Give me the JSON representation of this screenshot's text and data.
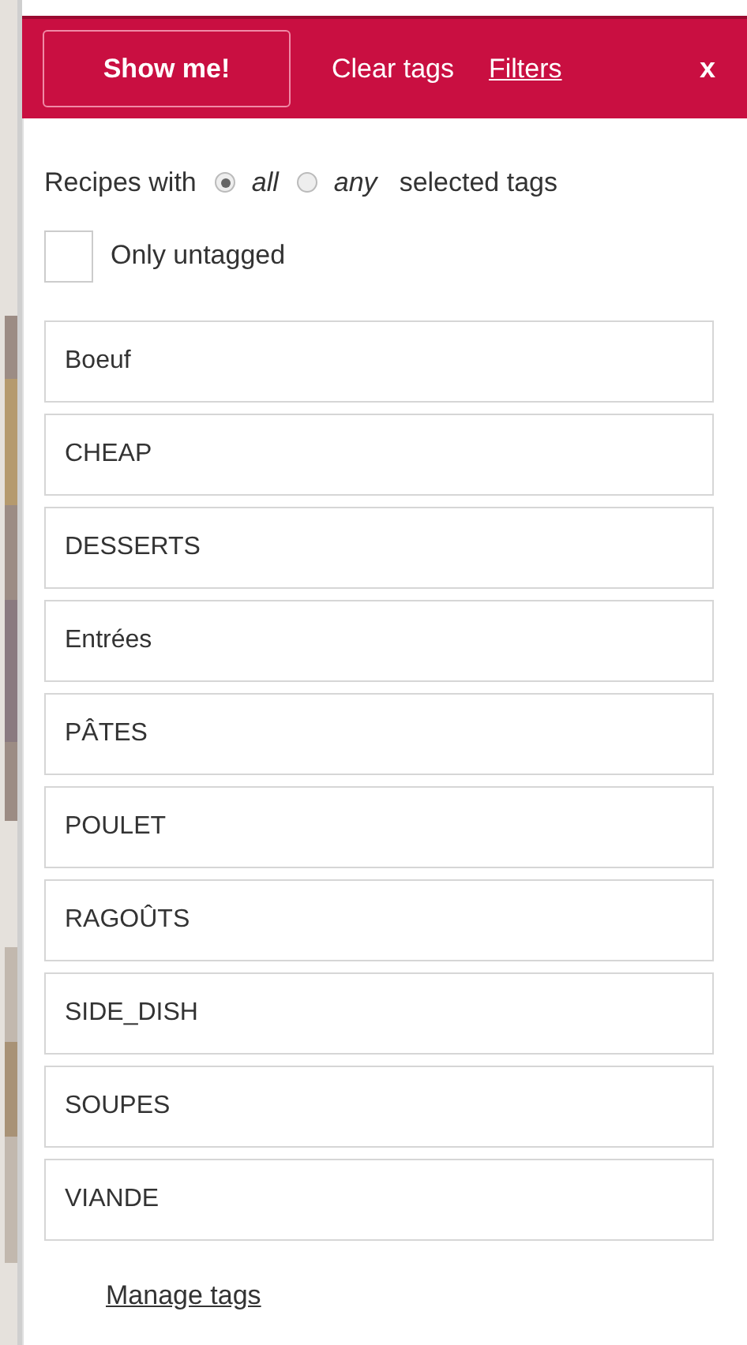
{
  "header": {
    "show_button": "Show me!",
    "clear_link": "Clear tags",
    "filters_link": "Filters",
    "close": "x"
  },
  "match": {
    "prefix": "Recipes with",
    "options": [
      {
        "label": "all",
        "selected": true
      },
      {
        "label": "any",
        "selected": false
      }
    ],
    "suffix": "selected tags"
  },
  "untagged": {
    "label": "Only untagged",
    "checked": false
  },
  "tags": [
    {
      "label": "Boeuf",
      "selected": false
    },
    {
      "label": "CHEAP",
      "selected": false
    },
    {
      "label": "DESSERTS",
      "selected": false
    },
    {
      "label": "Entrées",
      "selected": false
    },
    {
      "label": "PÂTES",
      "selected": false
    },
    {
      "label": "POULET",
      "selected": false
    },
    {
      "label": "RAGOÛTS",
      "selected": false
    },
    {
      "label": "SIDE_DISH",
      "selected": false
    },
    {
      "label": "SOUPES",
      "selected": false
    },
    {
      "label": "VIANDE",
      "selected": false
    }
  ],
  "manage_link": "Manage tags"
}
